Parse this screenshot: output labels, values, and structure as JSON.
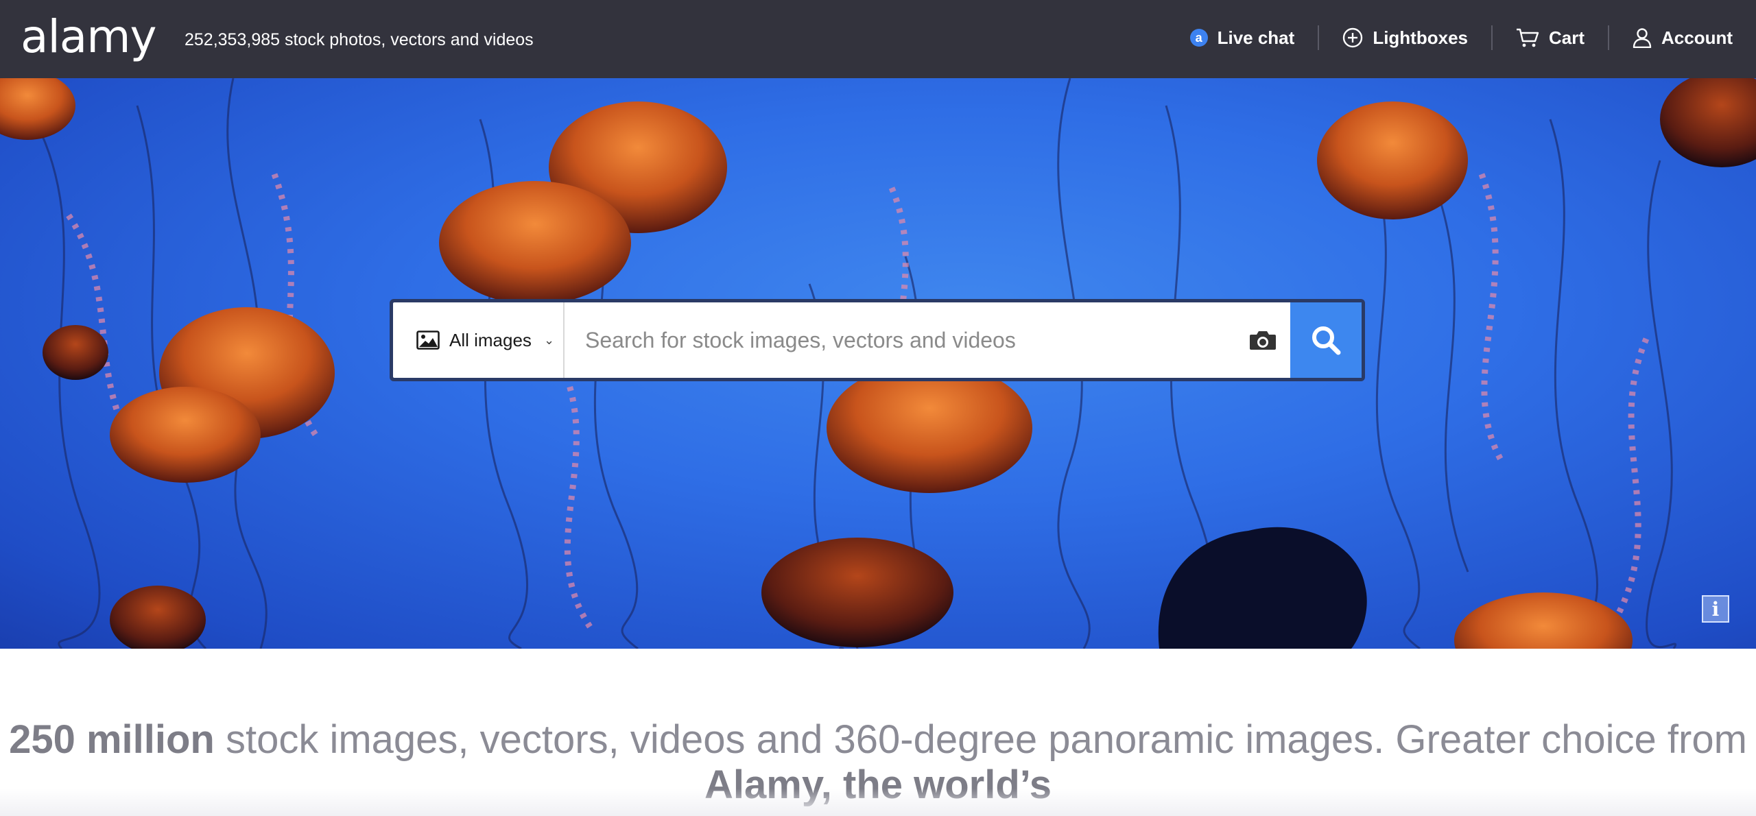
{
  "header": {
    "logo": "alamy",
    "tagline": "252,353,985 stock photos, vectors and videos",
    "nav": [
      {
        "label": "Live chat",
        "icon": "chat-badge-icon"
      },
      {
        "label": "Lightboxes",
        "icon": "plus-circle-icon"
      },
      {
        "label": "Cart",
        "icon": "cart-icon"
      },
      {
        "label": "Account",
        "icon": "user-icon"
      }
    ],
    "chat_badge_letter": "a"
  },
  "search": {
    "type_label": "All images",
    "placeholder": "Search for stock images, vectors and videos",
    "value": ""
  },
  "hero": {
    "info_label": "i"
  },
  "intro": {
    "bold_lead": "250 million",
    "text_1": " stock images, vectors, videos and 360-degree panoramic images. Greater choice from ",
    "bold_tail": "Alamy, the world’s"
  },
  "colors": {
    "topbar": "#33333d",
    "accent": "#3d87ef",
    "hero_blue": "#2f6ee6",
    "jelly_orange": "#c8541c"
  }
}
